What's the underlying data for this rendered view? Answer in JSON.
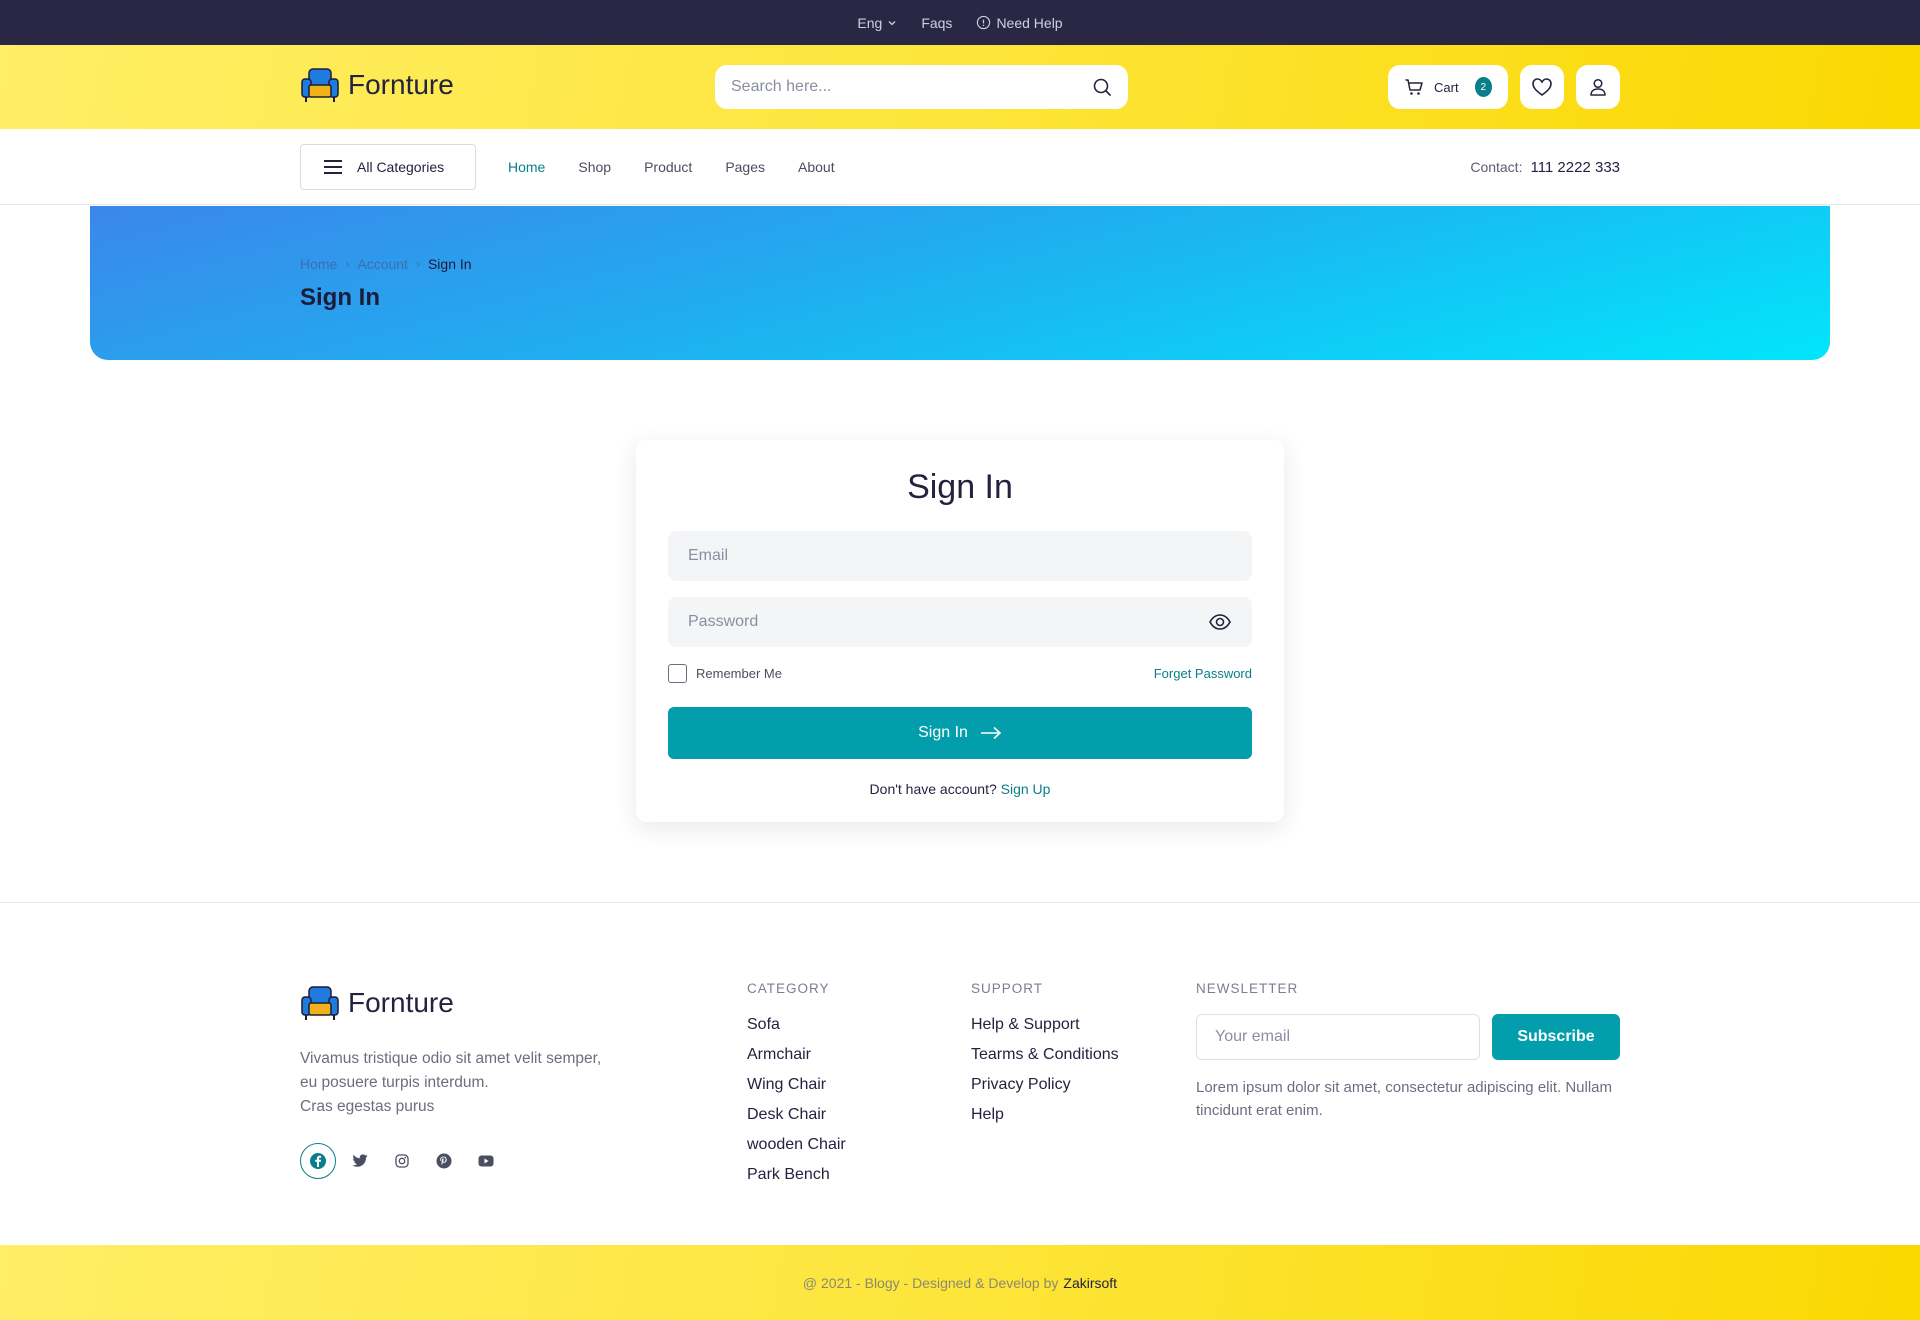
{
  "topbar": {
    "language": "Eng",
    "faqs": "Faqs",
    "help": "Need Help"
  },
  "brand": {
    "name": "Fornture"
  },
  "header": {
    "search_placeholder": "Search here...",
    "cart_label": "Cart",
    "cart_count": "2"
  },
  "nav": {
    "categories_label": "All Categories",
    "links": [
      "Home",
      "Shop",
      "Product",
      "Pages",
      "About"
    ],
    "active": "Home",
    "contact_label": "Contact:",
    "contact_phone": "111 2222 333"
  },
  "banner": {
    "breadcrumb": [
      "Home",
      "Account",
      "Sign In"
    ],
    "title": "Sign In"
  },
  "signin": {
    "title": "Sign In",
    "email_placeholder": "Email",
    "password_placeholder": "Password",
    "remember_label": "Remember Me",
    "forget_label": "Forget Password",
    "submit_label": "Sign In",
    "no_account_text": "Don't have account?",
    "signup_label": "Sign Up"
  },
  "footer": {
    "about_lines": [
      "Vivamus tristique odio sit amet velit semper,",
      "eu posuere turpis interdum.",
      "Cras egestas purus"
    ],
    "socials": [
      "facebook-icon",
      "twitter-icon",
      "instagram-icon",
      "pinterest-icon",
      "youtube-icon"
    ],
    "category": {
      "title": "CATEGORY",
      "items": [
        "Sofa",
        "Armchair",
        "Wing Chair",
        "Desk Chair",
        "wooden Chair",
        "Park Bench"
      ]
    },
    "support": {
      "title": "SUPPORT",
      "items": [
        "Help & Support",
        "Tearms & Conditions",
        "Privacy Policy",
        "Help"
      ]
    },
    "newsletter": {
      "title": "NEWSLETTER",
      "email_placeholder": "Your email",
      "button_label": "Subscribe",
      "description": "Lorem ipsum dolor sit amet, consectetur adipiscing elit. Nullam tincidunt erat enim."
    },
    "copyright": "@ 2021 - Blogy - Designed & Develop by",
    "author": "Zakirsoft"
  },
  "colors": {
    "primary": "#029eac",
    "accent_text": "#0a7f8a",
    "topbar": "#2a2744",
    "header_yellow": "#fde53a",
    "brand_blue": "#1f7bdc"
  }
}
